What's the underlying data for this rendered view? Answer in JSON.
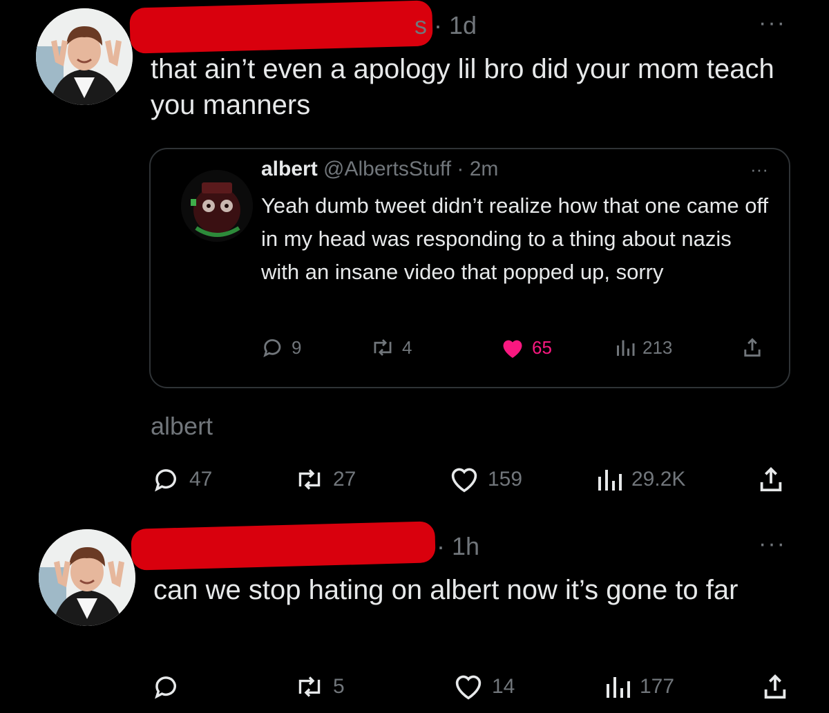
{
  "tweet1": {
    "time_suffix": "s · 1d",
    "more": "···",
    "text": "that ain’t even a apology lil bro did your mom teach you manners",
    "quote": {
      "name": "albert",
      "handle": "@AlbertsStuff · 2m",
      "more": "···",
      "text": "Yeah dumb tweet didn’t realize how that one came off in my head was responding to a thing about nazis with an insane video that popped up, sorry",
      "stats": {
        "replies": "9",
        "reposts": "4",
        "likes": "65",
        "views": "213"
      },
      "like_color": "#f91880"
    },
    "quote_label": "albert",
    "stats": {
      "replies": "47",
      "reposts": "27",
      "likes": "159",
      "views": "29.2K"
    }
  },
  "tweet2": {
    "time_suffix": "· 1h",
    "more": "···",
    "text": "can we stop hating on albert now it’s gone to far",
    "stats": {
      "replies": "",
      "reposts": "5",
      "likes": "14",
      "views": "177"
    }
  },
  "colors": {
    "background": "#000000",
    "text": "#e7e9ea",
    "muted": "#71767b",
    "redaction": "#d9000d",
    "like": "#f91880",
    "border": "#2f3336"
  },
  "icons": [
    "avatar-photo",
    "reply-icon",
    "repost-icon",
    "like-icon",
    "views-icon",
    "share-icon",
    "more-icon"
  ]
}
